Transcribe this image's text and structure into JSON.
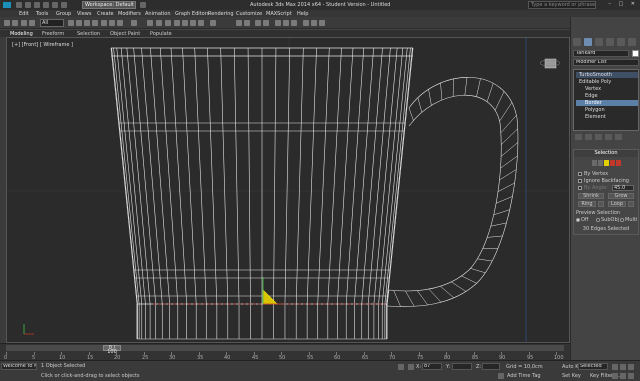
{
  "titlebar": {
    "workspace": "Workspace: Default",
    "title": "Autodesk 3ds Max 2014 x64 - Student Version - Untitled",
    "search_placeholder": "Type a keyword or phrase",
    "window_controls": "– □ ✕"
  },
  "menu": [
    "Edit",
    "Tools",
    "Group",
    "Views",
    "Create",
    "Modifiers",
    "Animation",
    "Graph Editors",
    "Rendering",
    "Customize",
    "MAXScript",
    "Help"
  ],
  "toolbar": {
    "selection_filter": "All"
  },
  "ribbon": {
    "tabs": [
      "Modeling",
      "Freeform",
      "Selection",
      "Object Paint",
      "Populate"
    ]
  },
  "viewport": {
    "label": "[+] [Front] [ Wireframe ]"
  },
  "command_panel": {
    "object_name": "Tankard",
    "modifier_list": "Modifier List",
    "stack": [
      "TurboSmooth",
      "Editable Poly",
      "Vertex",
      "Edge",
      "Border",
      "Polygon",
      "Element"
    ],
    "selection": {
      "title": "Selection",
      "by_vertex": "By Vertex",
      "ignore_backfacing": "Ignore Backfacing",
      "by_angle": "By Angle:",
      "by_angle_value": "45.0",
      "shrink": "Shrink",
      "grow": "Grow",
      "ring": "Ring",
      "loop": "Loop",
      "preview_selection": "Preview Selection",
      "off": "Off",
      "subobj": "SubObj",
      "multi": "Multi",
      "status": "30 Edges Selected"
    }
  },
  "timeline": {
    "frame": "0 / 100",
    "ruler": [
      "0",
      "5",
      "10",
      "15",
      "20",
      "25",
      "30",
      "35",
      "40",
      "45",
      "50",
      "55",
      "60",
      "65",
      "70",
      "75",
      "80",
      "85",
      "90",
      "95",
      "100"
    ]
  },
  "status": {
    "script": "Welcome to M",
    "objects": "1 Object Selected",
    "hint": "Click or click-and-drag to select objects",
    "x": "87",
    "grid": "Grid = 10,0cm",
    "add_time_tag": "Add Time Tag",
    "auto_key": "Auto Key",
    "auto_key_sel": "Selected",
    "set_key": "Set Key",
    "key_filters": "Key Filters..."
  }
}
